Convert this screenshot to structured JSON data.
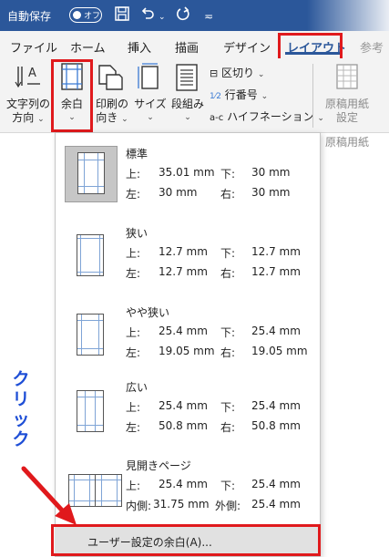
{
  "titlebar": {
    "autosave_label": "自動保存",
    "autosave_toggle": "オフ",
    "icons": [
      "save-icon",
      "undo-icon",
      "redo-icon",
      "customize-icon"
    ]
  },
  "tabs": [
    "ファイル",
    "ホーム",
    "挿入",
    "描画",
    "デザイン",
    "レイアウト",
    "参考"
  ],
  "active_tab": "レイアウト",
  "ribbon": {
    "text_direction": {
      "line1": "文字列の",
      "line2": "方向"
    },
    "margins": {
      "line1": "余白"
    },
    "orientation": {
      "line1": "印刷の",
      "line2": "向き"
    },
    "size": {
      "line1": "サイズ"
    },
    "columns": {
      "line1": "段組み"
    },
    "breaks": "区切り",
    "line_numbers": "行番号",
    "hyphenation": "ハイフネーション",
    "manuscript": {
      "line1": "原稿用紙",
      "line2": "設定",
      "group": "原稿用紙"
    }
  },
  "margin_presets": [
    {
      "name": "標準",
      "rows": [
        {
          "k1": "上:",
          "v1": "35.01 mm",
          "k2": "下:",
          "v2": "30 mm"
        },
        {
          "k1": "左:",
          "v1": "30 mm",
          "k2": "右:",
          "v2": "30 mm"
        }
      ]
    },
    {
      "name": "狭い",
      "rows": [
        {
          "k1": "上:",
          "v1": "12.7 mm",
          "k2": "下:",
          "v2": "12.7 mm"
        },
        {
          "k1": "左:",
          "v1": "12.7 mm",
          "k2": "右:",
          "v2": "12.7 mm"
        }
      ]
    },
    {
      "name": "やや狭い",
      "rows": [
        {
          "k1": "上:",
          "v1": "25.4 mm",
          "k2": "下:",
          "v2": "25.4 mm"
        },
        {
          "k1": "左:",
          "v1": "19.05 mm",
          "k2": "右:",
          "v2": "19.05 mm"
        }
      ]
    },
    {
      "name": "広い",
      "rows": [
        {
          "k1": "上:",
          "v1": "25.4 mm",
          "k2": "下:",
          "v2": "25.4 mm"
        },
        {
          "k1": "左:",
          "v1": "50.8 mm",
          "k2": "右:",
          "v2": "50.8 mm"
        }
      ]
    },
    {
      "name": "見開きページ",
      "rows": [
        {
          "k1": "上:",
          "v1": "25.4 mm",
          "k2": "下:",
          "v2": "25.4 mm"
        },
        {
          "k1": "内側:",
          "v1": "31.75 mm",
          "k2": "外側:",
          "v2": "25.4 mm"
        }
      ]
    }
  ],
  "custom_margins_label": "ユーザー設定の余白(A)...",
  "annotation": {
    "text": "クリック",
    "color": "#1f4fd6",
    "highlight_color": "#e0191c"
  },
  "colors": {
    "brand": "#2b579a",
    "ribbon_bg": "#f3f3f3",
    "selected_thumb": "#c6c6c6"
  }
}
